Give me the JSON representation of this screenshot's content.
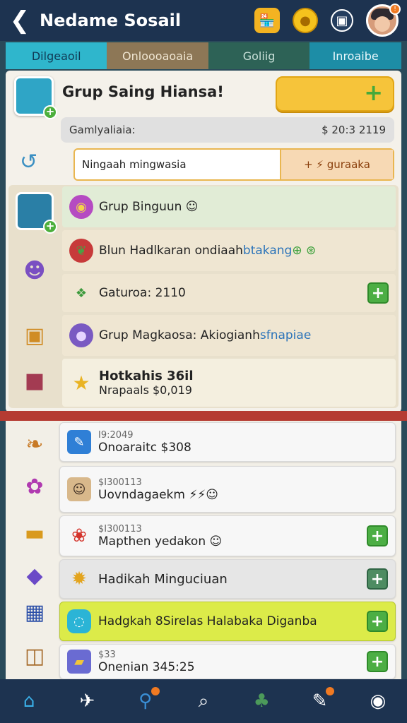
{
  "header": {
    "back": "❮",
    "title": "Nedame Sosail",
    "icons": {
      "shop": "🏪",
      "coin": "●",
      "box": "▣"
    },
    "avatar_badge": "!"
  },
  "tabs": [
    {
      "label": "Dilgeaoil"
    },
    {
      "label": "Onloooaoaia"
    },
    {
      "label": "Goliig"
    },
    {
      "label": "Inroaibe"
    }
  ],
  "group": {
    "title": "Grup Saing Hiansa!",
    "add_glyph": "+",
    "info_label": "Gamlyaliaia:",
    "info_value": "$ 20:3 2119",
    "input_value": "Ningaah mingwasia",
    "input_button": "+ ⚡ guraaka"
  },
  "list_rows": [
    {
      "icon": "◉",
      "text": "Grup Binguun ☺"
    },
    {
      "icon": "❦",
      "text": "Blun Hadlkaran ondiaah ",
      "accent": "btakang",
      "tail": " ⊕ ⊛"
    },
    {
      "icon": "❖",
      "text": "Gaturoa: 2110"
    },
    {
      "icon": "●",
      "text": "Grup Magkaosa: Akiogianh ",
      "accent": "sfnapiae"
    },
    {
      "icon": "★",
      "title": "Hotkahis 36il",
      "sub": "Nrapaals $0,019"
    }
  ],
  "lower_rows": [
    {
      "icon": "✎",
      "small": "I9:2049",
      "main": "Onoaraitc $308"
    },
    {
      "icon": "☺",
      "small": "$I300113",
      "main": "Uovndagaekm ⚡⚡☺"
    },
    {
      "icon": "❀",
      "small": "$I300113",
      "main": "Mapthen yedakon ☺"
    },
    {
      "icon": "✹",
      "main": "Hadikah Minguciuan"
    },
    {
      "icon": "◌",
      "main": "Hadgkah 8Sirelas Halabaka Diganba"
    },
    {
      "icon": "▰",
      "small": "$33",
      "main": "Onenian 345:25"
    }
  ],
  "bottom_nav": [
    {
      "icon": "⌂",
      "name": "home"
    },
    {
      "icon": "✈",
      "name": "send"
    },
    {
      "icon": "⚲",
      "name": "link"
    },
    {
      "icon": "⌕",
      "name": "search"
    },
    {
      "icon": "♣",
      "name": "clover"
    },
    {
      "icon": "✎",
      "name": "edit"
    },
    {
      "icon": "◉",
      "name": "location"
    }
  ],
  "colors": {
    "topbar": "#1d3350",
    "accent_green": "#4cae44",
    "accent_yellow": "#f6c43a",
    "tab_active": "#2fb6cc"
  }
}
